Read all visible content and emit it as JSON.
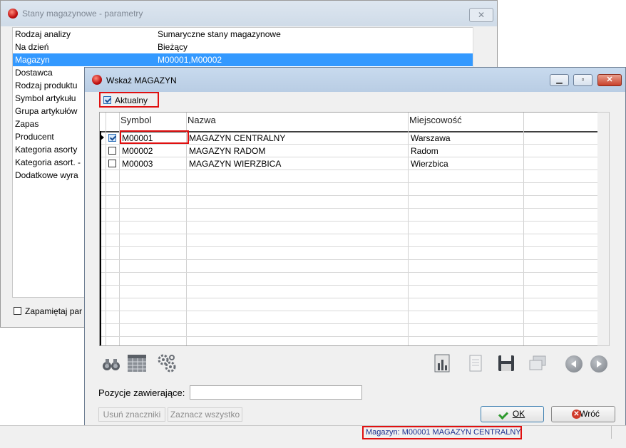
{
  "background_window": {
    "title": "Stany magazynowe - parametry",
    "close_label": "✕",
    "rows": [
      {
        "label": "Rodzaj analizy",
        "value": "Sumaryczne stany magazynowe"
      },
      {
        "label": "Na dzień",
        "value": "Bieżący"
      },
      {
        "label": "Magazyn",
        "value": "M00001,M00002"
      },
      {
        "label": "Dostawca",
        "value": ""
      },
      {
        "label": "Rodzaj produktu",
        "value": ""
      },
      {
        "label": "Symbol artykułu",
        "value": ""
      },
      {
        "label": "Grupa artykułów",
        "value": ""
      },
      {
        "label": "Zapas",
        "value": ""
      },
      {
        "label": "Producent",
        "value": ""
      },
      {
        "label": "Kategoria asorty",
        "value": ""
      },
      {
        "label": "Kategoria asort. -",
        "value": ""
      },
      {
        "label": "Dodatkowe wyra",
        "value": ""
      }
    ],
    "remember_label": "Zapamiętaj par"
  },
  "dialog": {
    "title": "Wskaż MAGAZYN",
    "aktualny_label": "Aktualny",
    "columns": [
      "Symbol",
      "Nazwa",
      "Miejscowość"
    ],
    "rows": [
      {
        "symbol": "M00001",
        "name": "MAGAZYN CENTRALNY",
        "city": "Warszawa",
        "checked": true
      },
      {
        "symbol": "M00002",
        "name": "MAGAZYN RADOM",
        "city": "Radom",
        "checked": false
      },
      {
        "symbol": "M00003",
        "name": "MAGAZYN WIERZBICA",
        "city": "Wierzbica",
        "checked": false
      }
    ],
    "positions_label": "Pozycje zawierające:",
    "positions_value": "",
    "remove_marks_label": "Usuń znaczniki",
    "select_all_label": "Zaznacz wszystko",
    "ok_label": "OK",
    "back_label": "Wróć"
  },
  "statusbar": {
    "text": "Magazyn: M00001 MAGAZYN CENTRALNY"
  },
  "colors": {
    "highlight_row": "#3399ff",
    "annotation_red": "#e01010"
  }
}
